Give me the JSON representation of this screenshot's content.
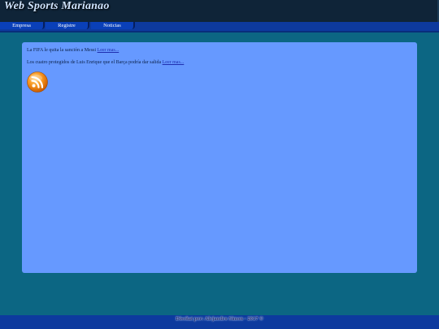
{
  "header": {
    "site_title": "Web Sports Marianao"
  },
  "nav": {
    "items": [
      {
        "label": "Empresa"
      },
      {
        "label": "Registre"
      },
      {
        "label": "Noticias"
      }
    ]
  },
  "news": [
    {
      "text": "La FIFA le quita la sanción a Messi",
      "link_label": "Leer mas..."
    },
    {
      "text": "Los cuatro protegidos de Luis Enrique que el Barça podría dar salida",
      "link_label": "Leer mas..."
    }
  ],
  "rss": {
    "icon": "rss-icon",
    "color": "#f7941d"
  },
  "footer": {
    "credit": "Diseñat per: Alejandro Simon - 2017 ©"
  },
  "colors": {
    "page_bg": "#0c6683",
    "header_bg": "#0f2438",
    "nav_bg": "#0d3a9e",
    "content_bg": "#6699ff"
  }
}
